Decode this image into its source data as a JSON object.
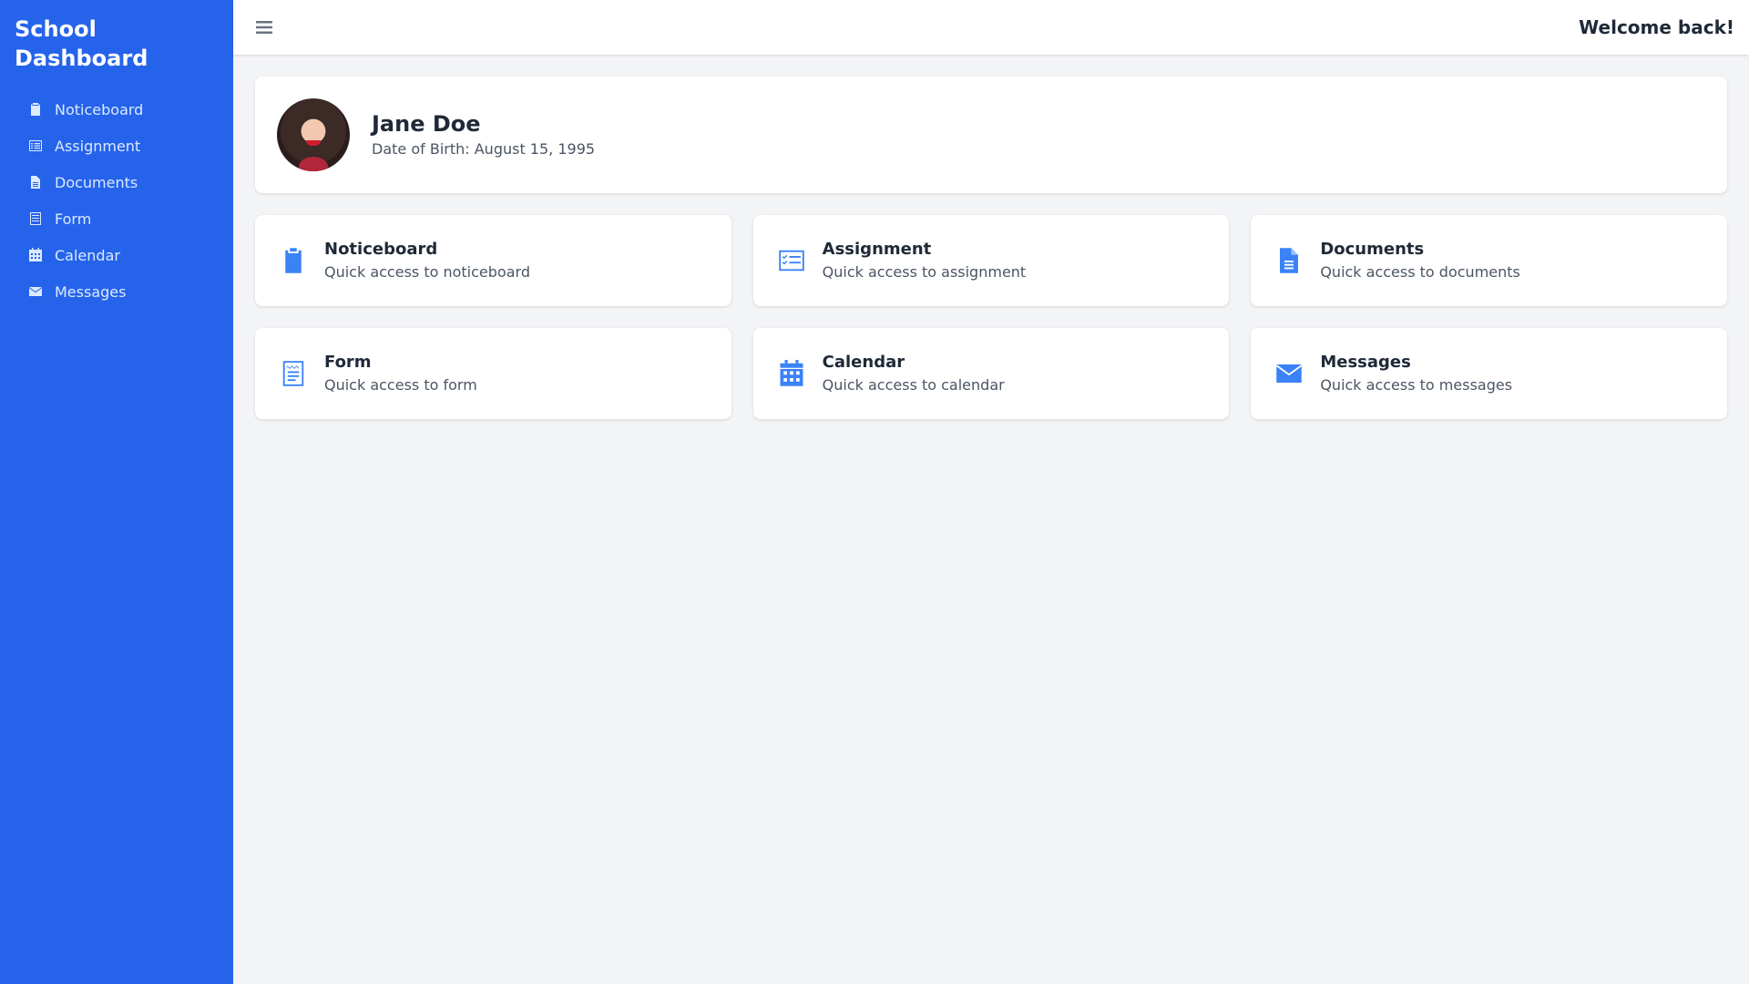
{
  "sidebar": {
    "brand": "School Dashboard",
    "items": [
      {
        "label": "Noticeboard",
        "icon": "clipboard-icon"
      },
      {
        "label": "Assignment",
        "icon": "checklist-icon"
      },
      {
        "label": "Documents",
        "icon": "document-icon"
      },
      {
        "label": "Form",
        "icon": "form-icon"
      },
      {
        "label": "Calendar",
        "icon": "calendar-icon"
      },
      {
        "label": "Messages",
        "icon": "envelope-icon"
      }
    ]
  },
  "header": {
    "menu_icon": "hamburger-menu-icon",
    "welcome": "Welcome back!"
  },
  "profile": {
    "name": "Jane Doe",
    "dob": "Date of Birth: August 15, 1995"
  },
  "tiles": [
    {
      "title": "Noticeboard",
      "subtitle": "Quick access to noticeboard",
      "icon": "clipboard-icon"
    },
    {
      "title": "Assignment",
      "subtitle": "Quick access to assignment",
      "icon": "checklist-icon"
    },
    {
      "title": "Documents",
      "subtitle": "Quick access to documents",
      "icon": "document-icon"
    },
    {
      "title": "Form",
      "subtitle": "Quick access to form",
      "icon": "form-icon"
    },
    {
      "title": "Calendar",
      "subtitle": "Quick access to calendar",
      "icon": "calendar-icon"
    },
    {
      "title": "Messages",
      "subtitle": "Quick access to messages",
      "icon": "envelope-icon"
    }
  ],
  "colors": {
    "sidebar_bg": "#2563eb",
    "accent": "#3b82f6",
    "page_bg": "#f3f4f6"
  }
}
